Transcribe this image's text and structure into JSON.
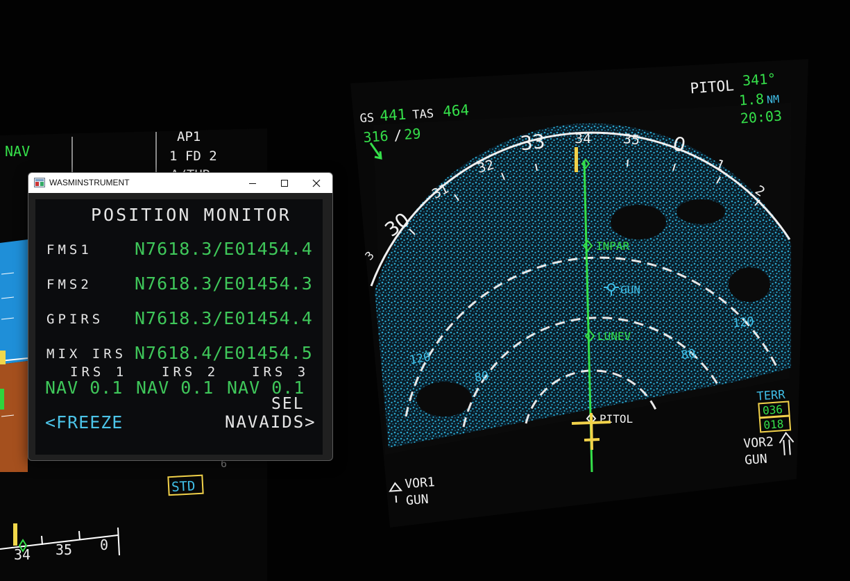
{
  "window": {
    "title": "WASMINSTRUMENT",
    "icon": "app-icon",
    "controls": [
      "minimize-icon",
      "maximize-icon",
      "close-icon"
    ]
  },
  "mcdu": {
    "title": "POSITION MONITOR",
    "rows": [
      {
        "label": "FMS1",
        "value": "N7618.3/E01454.4"
      },
      {
        "label": "FMS2",
        "value": "N7618.3/E01454.3"
      },
      {
        "label": "GPIRS",
        "value": "N7618.3/E01454.4"
      },
      {
        "label": "MIX IRS",
        "value": "N7618.4/E01454.5"
      }
    ],
    "irs_labels": [
      "IRS 1",
      "IRS 2",
      "IRS 3"
    ],
    "irs_values": [
      "NAV 0.1",
      "NAV 0.1",
      "NAV 0.1"
    ],
    "sel_label": "SEL",
    "freeze": "<FREEZE",
    "navaids": "NAVAIDS>",
    "colors": {
      "white": "#e6e6e6",
      "green": "#3fc75a",
      "cyan": "#4cc4e8"
    }
  },
  "pfd": {
    "nav_mode": "NAV",
    "ap1": "AP1",
    "fd": "1 FD 2",
    "athr": "A/THR",
    "baro": "STD",
    "heading_ticks": [
      "34",
      "35",
      "0"
    ]
  },
  "nd": {
    "gs_label": "GS",
    "gs": "441",
    "tas_label": "TAS",
    "tas": "464",
    "wind_dir": "316",
    "wind_sep": "/",
    "wind_spd": "29",
    "waypoint": "PITOL",
    "wpt_bearing": "341°",
    "wpt_dist": "1.8",
    "wpt_dist_unit": "NM",
    "wpt_eta": "20:03",
    "compass": [
      "30",
      "31",
      "32",
      "33",
      "34",
      "35",
      "0",
      "1",
      "2",
      "3"
    ],
    "fixes": [
      "INPAR",
      "GUN",
      "LUNEV",
      "PITOL"
    ],
    "range_labels": [
      "120",
      "80",
      "80",
      "120"
    ],
    "terr_label": "TERR",
    "terr_upper": "036",
    "terr_lower": "018",
    "vor1": "VOR1",
    "vor1_id": "GUN",
    "vor2": "VOR2",
    "vor2_id": "GUN",
    "colors": {
      "green": "#35e04a",
      "cyan": "#40bfe8",
      "white": "#f0f0f0",
      "yellow": "#f2d24a",
      "weather": "#2aa6cc"
    }
  }
}
